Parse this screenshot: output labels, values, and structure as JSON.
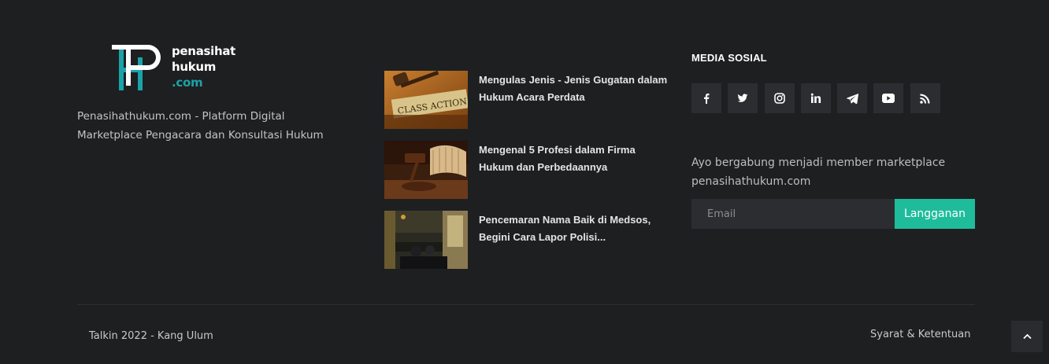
{
  "brand": {
    "logo_line1": "penasihat",
    "logo_line2": "hukum",
    "logo_line3": ".com",
    "logo_mark_letters": "PH",
    "description": "Penasihathukum.com - Platform Digital Marketplace Pengacara dan Konsultasi Hukum",
    "accent_color": "#1aa3a8"
  },
  "posts": [
    {
      "title": "Mengulas Jenis - Jenis Gugatan dalam Hukum Acara Perdata",
      "thumb_caption": "CLASS ACTION"
    },
    {
      "title": "Mengenal 5 Profesi dalam Firma Hukum dan Perbedaannya"
    },
    {
      "title": "Pencemaran Nama Baik di Medsos, Begini Cara Lapor Polisi..."
    }
  ],
  "social": {
    "heading": "MEDIA SOSIAL",
    "icons": [
      "facebook-icon",
      "twitter-icon",
      "instagram-icon",
      "linkedin-icon",
      "telegram-icon",
      "youtube-icon",
      "rss-icon"
    ]
  },
  "newsletter": {
    "text": "Ayo bergabung menjadi member marketplace penasihathukum.com",
    "email_placeholder": "Email",
    "button_label": "Langganan",
    "button_color": "#1fbc9c"
  },
  "footer": {
    "copyright": "Talkin 2022 - Kang Ulum",
    "terms_link": "Syarat & Ketentuan",
    "back_to_top_icon": "chevron-up-icon"
  }
}
